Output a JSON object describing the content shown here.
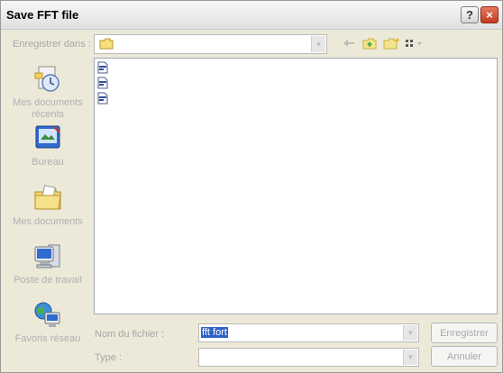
{
  "window": {
    "title": "Save FFT file"
  },
  "titlebar_buttons": {
    "help": "?",
    "close": "×"
  },
  "location": {
    "label": "Enregistrer dans :",
    "value": ""
  },
  "toolbar": {
    "icons": [
      "back-arrow-icon",
      "up-folder-icon",
      "new-folder-icon",
      "view-menu-icon"
    ]
  },
  "places": [
    {
      "label": "Mes documents récents",
      "icon": "recent-documents-icon"
    },
    {
      "label": "Bureau",
      "icon": "desktop-icon"
    },
    {
      "label": "Mes documents",
      "icon": "my-documents-icon"
    },
    {
      "label": "Poste de travail",
      "icon": "my-computer-icon"
    },
    {
      "label": "Favoris réseau",
      "icon": "network-places-icon"
    }
  ],
  "files": [
    {
      "name": "",
      "icon": "file-icon"
    },
    {
      "name": "",
      "icon": "file-icon"
    },
    {
      "name": "",
      "icon": "file-icon"
    }
  ],
  "filename": {
    "label": "Nom du fichier :",
    "value": "fft fort"
  },
  "filetype": {
    "label": "Type :",
    "value": ""
  },
  "buttons": {
    "save": "Enregistrer",
    "cancel": "Annuler"
  }
}
